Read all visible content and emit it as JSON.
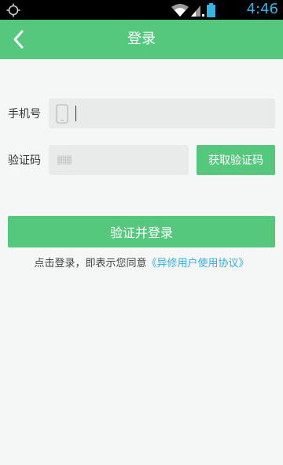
{
  "status_bar": {
    "time": "4:46",
    "icons": [
      "gps-icon",
      "wifi-icon",
      "signal-icon",
      "battery-icon"
    ]
  },
  "header": {
    "title": "登录",
    "back_icon": "back-arrow-icon"
  },
  "form": {
    "phone_label": "手机号",
    "phone_value": "",
    "code_label": "验证码",
    "code_value": "",
    "get_code_label": "获取验证码"
  },
  "actions": {
    "login_label": "验证并登录"
  },
  "agreement": {
    "prefix": "点击登录，即表示您同意",
    "link_text": "《异修用户使用协议》"
  },
  "colors": {
    "accent": "#56c87e",
    "link": "#35aede",
    "status_icon": "#35b5e5",
    "background": "#f5f6f6",
    "field_bg": "#e9eaea"
  }
}
